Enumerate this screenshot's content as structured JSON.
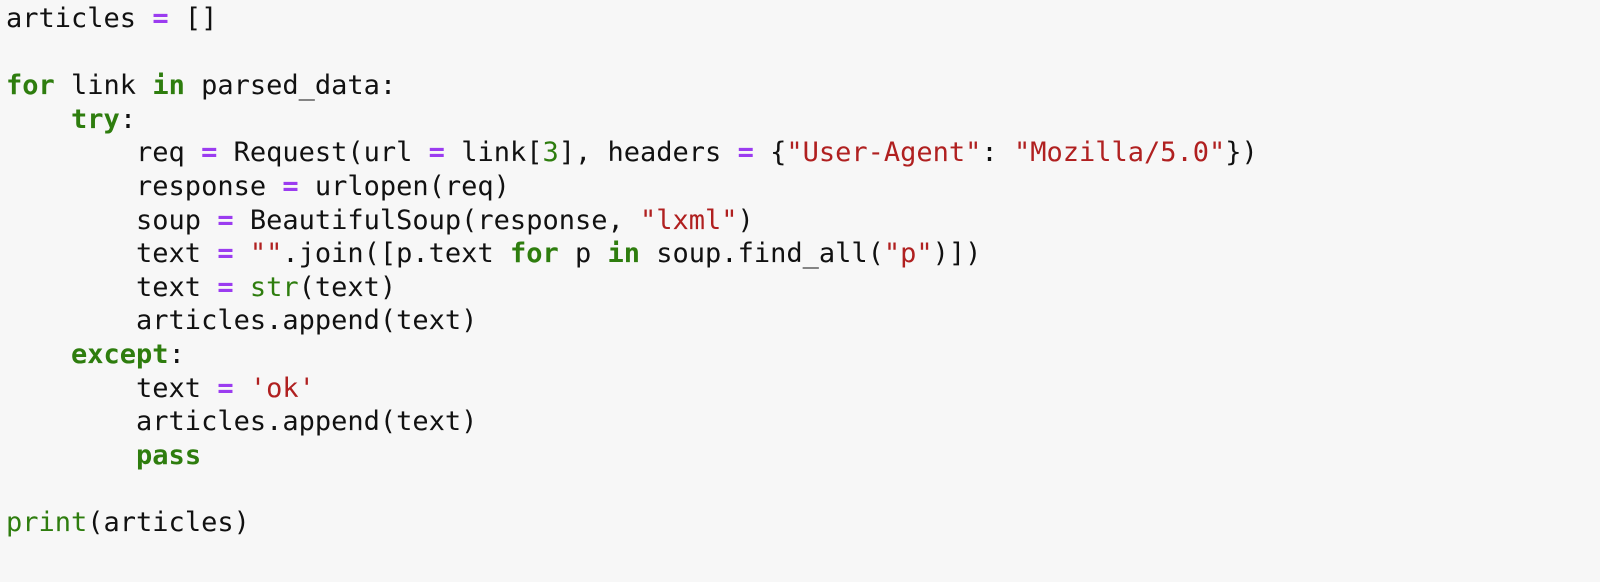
{
  "editor": {
    "background": "#f7f7f7",
    "colors": {
      "plain": "#111111",
      "keyword": "#2e7d0e",
      "builtin": "#2e7d0e",
      "operator": "#9b3cf0",
      "string": "#b02020",
      "number": "#2e7d0e"
    },
    "lines": [
      [
        {
          "t": "plain",
          "v": "articles "
        },
        {
          "t": "op",
          "v": "="
        },
        {
          "t": "plain",
          "v": " []"
        }
      ],
      [],
      [
        {
          "t": "kw",
          "v": "for"
        },
        {
          "t": "plain",
          "v": " link "
        },
        {
          "t": "kw",
          "v": "in"
        },
        {
          "t": "plain",
          "v": " parsed_data:"
        }
      ],
      [
        {
          "t": "plain",
          "v": "    "
        },
        {
          "t": "kw",
          "v": "try"
        },
        {
          "t": "plain",
          "v": ":"
        }
      ],
      [
        {
          "t": "plain",
          "v": "        req "
        },
        {
          "t": "op",
          "v": "="
        },
        {
          "t": "plain",
          "v": " Request(url "
        },
        {
          "t": "op",
          "v": "="
        },
        {
          "t": "plain",
          "v": " link["
        },
        {
          "t": "num",
          "v": "3"
        },
        {
          "t": "plain",
          "v": "], headers "
        },
        {
          "t": "op",
          "v": "="
        },
        {
          "t": "plain",
          "v": " {"
        },
        {
          "t": "str",
          "v": "\"User-Agent\""
        },
        {
          "t": "plain",
          "v": ": "
        },
        {
          "t": "str",
          "v": "\"Mozilla/5.0\""
        },
        {
          "t": "plain",
          "v": "})"
        }
      ],
      [
        {
          "t": "plain",
          "v": "        response "
        },
        {
          "t": "op",
          "v": "="
        },
        {
          "t": "plain",
          "v": " urlopen(req)"
        }
      ],
      [
        {
          "t": "plain",
          "v": "        soup "
        },
        {
          "t": "op",
          "v": "="
        },
        {
          "t": "plain",
          "v": " BeautifulSoup(response, "
        },
        {
          "t": "str",
          "v": "\"lxml\""
        },
        {
          "t": "plain",
          "v": ")"
        }
      ],
      [
        {
          "t": "plain",
          "v": "        text "
        },
        {
          "t": "op",
          "v": "="
        },
        {
          "t": "plain",
          "v": " "
        },
        {
          "t": "str",
          "v": "\"\""
        },
        {
          "t": "plain",
          "v": ".join([p.text "
        },
        {
          "t": "kw",
          "v": "for"
        },
        {
          "t": "plain",
          "v": " p "
        },
        {
          "t": "kw",
          "v": "in"
        },
        {
          "t": "plain",
          "v": " soup.find_all("
        },
        {
          "t": "str",
          "v": "\"p\""
        },
        {
          "t": "plain",
          "v": ")])"
        }
      ],
      [
        {
          "t": "plain",
          "v": "        text "
        },
        {
          "t": "op",
          "v": "="
        },
        {
          "t": "plain",
          "v": " "
        },
        {
          "t": "builtin",
          "v": "str"
        },
        {
          "t": "plain",
          "v": "(text)"
        }
      ],
      [
        {
          "t": "plain",
          "v": "        articles.append(text)"
        }
      ],
      [
        {
          "t": "plain",
          "v": "    "
        },
        {
          "t": "kw",
          "v": "except"
        },
        {
          "t": "plain",
          "v": ":"
        }
      ],
      [
        {
          "t": "plain",
          "v": "        text "
        },
        {
          "t": "op",
          "v": "="
        },
        {
          "t": "plain",
          "v": " "
        },
        {
          "t": "str",
          "v": "'ok'"
        }
      ],
      [
        {
          "t": "plain",
          "v": "        articles.append(text)"
        }
      ],
      [
        {
          "t": "plain",
          "v": "        "
        },
        {
          "t": "kw",
          "v": "pass"
        }
      ],
      [],
      [
        {
          "t": "builtin",
          "v": "print"
        },
        {
          "t": "plain",
          "v": "(articles)"
        }
      ]
    ]
  }
}
